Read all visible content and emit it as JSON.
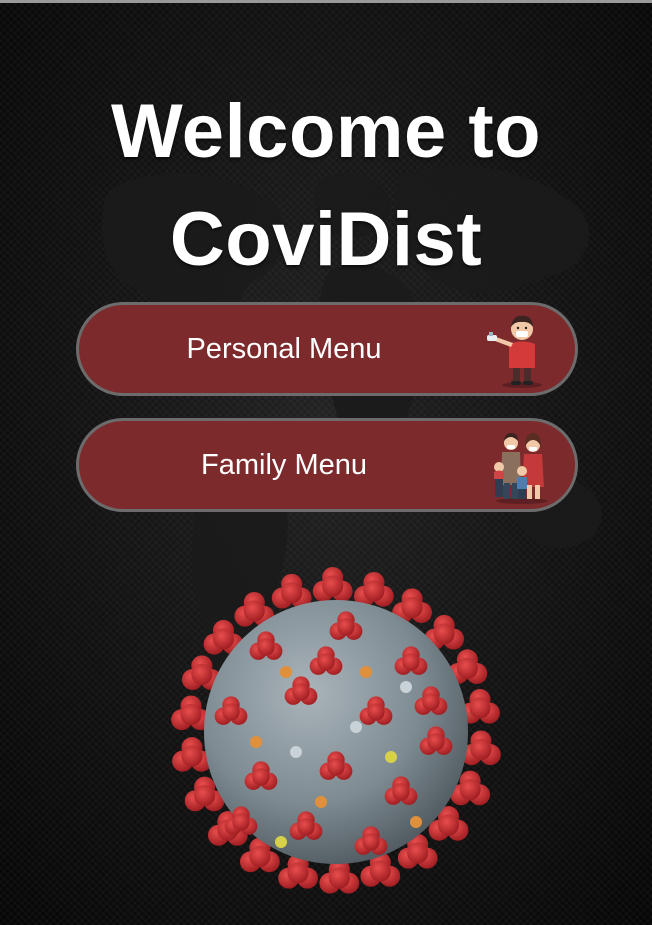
{
  "title": {
    "line1": "Welcome to",
    "line2": "CoviDist"
  },
  "menu": {
    "personal_label": "Personal Menu",
    "family_label": "Family Menu"
  },
  "icons": {
    "personal": "person-sanitizer-icon",
    "family": "family-icon",
    "hero": "coronavirus-illustration"
  },
  "colors": {
    "background": "#0b0b0b",
    "button": "#7d2a2c",
    "button_border": "#6c6c6c",
    "text": "#ffffff",
    "virus_spike": "#c8262b",
    "virus_body": "#7e8b92"
  }
}
